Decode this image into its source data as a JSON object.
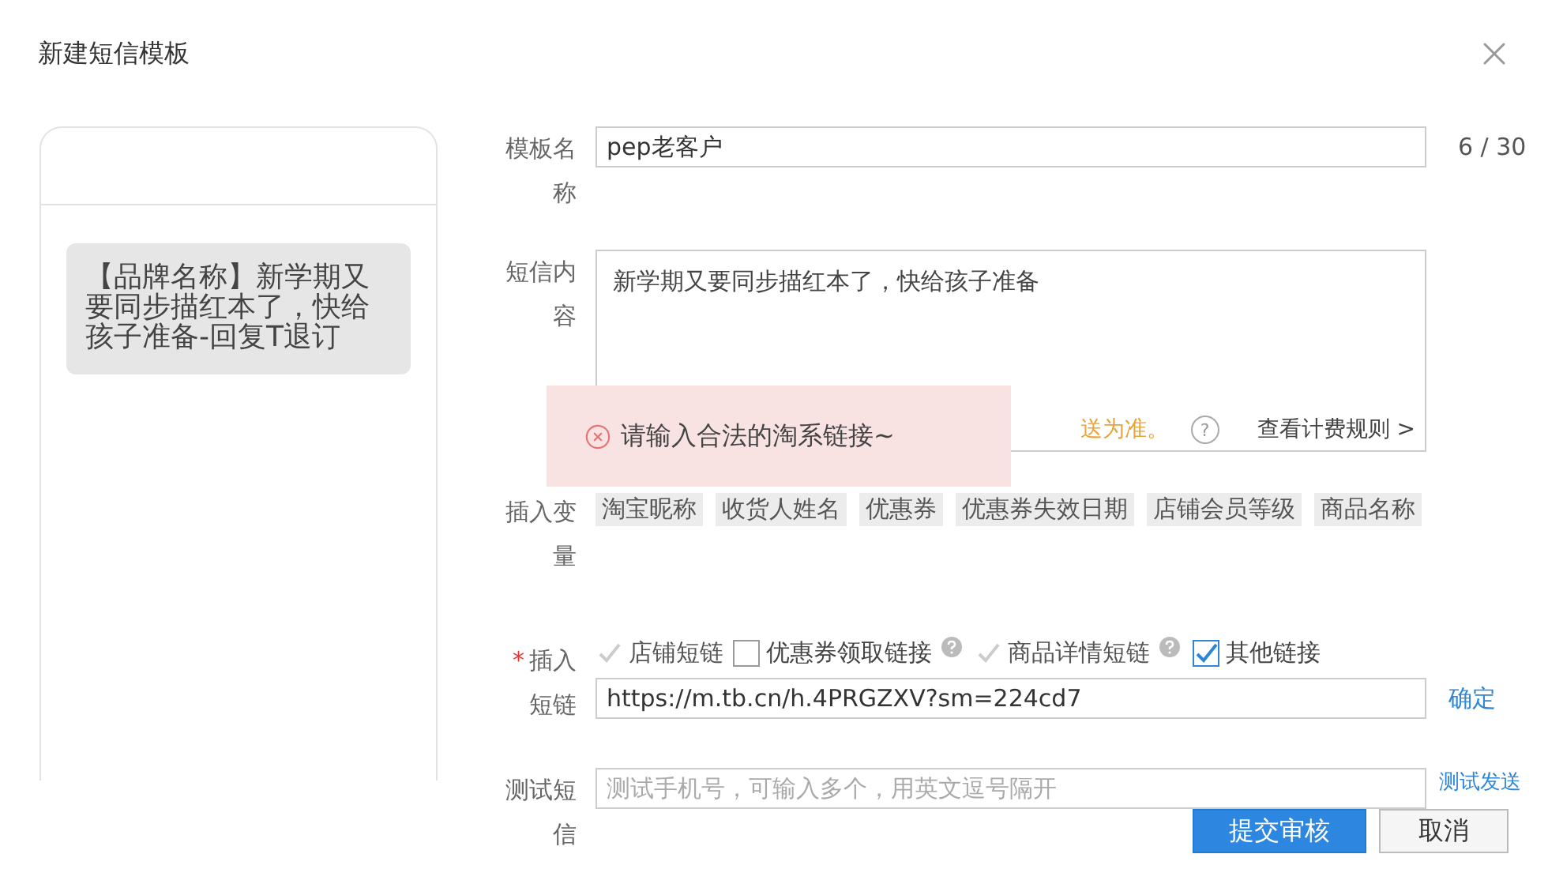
{
  "dialog": {
    "title": "新建短信模板"
  },
  "preview": {
    "message": "【品牌名称】新学期又要同步描红本了，快给孩子准备-回复T退订"
  },
  "form": {
    "name": {
      "label": "模板名称",
      "value": "pep老客户",
      "counter": "6 / 30"
    },
    "content": {
      "label": "短信内容",
      "value": "新学期又要同步描红本了，快给孩子准备",
      "billing_note": "送为准。",
      "help_mark": "?",
      "billing_link": "查看计费规则 >"
    },
    "variables": {
      "label": "插入变量",
      "tags": [
        "淘宝昵称",
        "收货人姓名",
        "优惠券",
        "优惠券失效日期",
        "店铺会员等级",
        "商品名称"
      ]
    },
    "shortlinks": {
      "required_mark": "*",
      "label": "插入短链",
      "options": [
        {
          "label": "店铺短链",
          "checked": true,
          "disabled": true,
          "help": false
        },
        {
          "label": "优惠券领取链接",
          "checked": false,
          "disabled": false,
          "help": true
        },
        {
          "label": "商品详情短链",
          "checked": true,
          "disabled": true,
          "help": true
        },
        {
          "label": "其他链接",
          "checked": true,
          "disabled": false,
          "help": false
        }
      ],
      "url": "https://m.tb.cn/h.4PRGZXV?sm=224cd7",
      "confirm": "确定"
    },
    "test": {
      "label": "测试短信",
      "placeholder": "测试手机号，可输入多个，用英文逗号隔开",
      "link": "测试发送"
    }
  },
  "toast": {
    "message": "请输入合法的淘系链接~"
  },
  "buttons": [
    {
      "label": "提交审核",
      "kind": "primary"
    },
    {
      "label": "取消",
      "kind": "default"
    }
  ]
}
